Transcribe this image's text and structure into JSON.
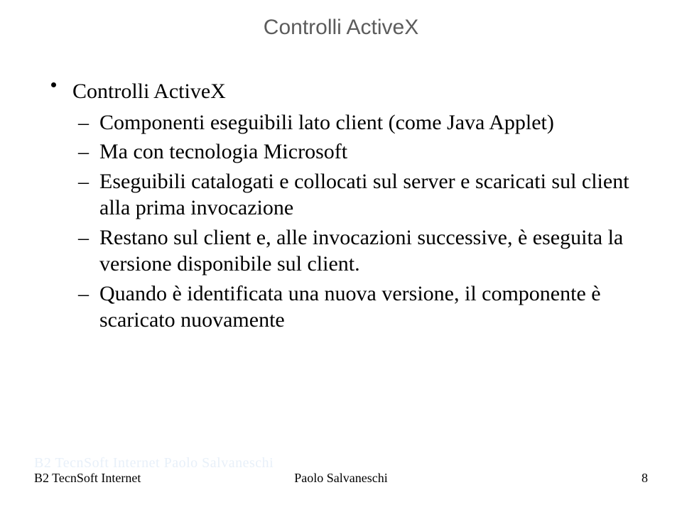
{
  "title": "Controlli ActiveX",
  "bullets": {
    "main": "Controlli ActiveX",
    "subs": [
      "Componenti eseguibili lato client (come Java Applet)",
      "Ma con tecnologia Microsoft",
      "Eseguibili catalogati e collocati sul server e scaricati sul client alla prima invocazione",
      "Restano sul client e, alle invocazioni successive, è eseguita la versione disponibile sul client.",
      "Quando è identificata una nuova versione, il componente è scaricato nuovamente"
    ]
  },
  "ghost_text": "B2 TecnSoft Internet Paolo Salvaneschi",
  "footer": {
    "left": "B2 TecnSoft Internet",
    "center": "Paolo Salvaneschi",
    "page": "8"
  }
}
